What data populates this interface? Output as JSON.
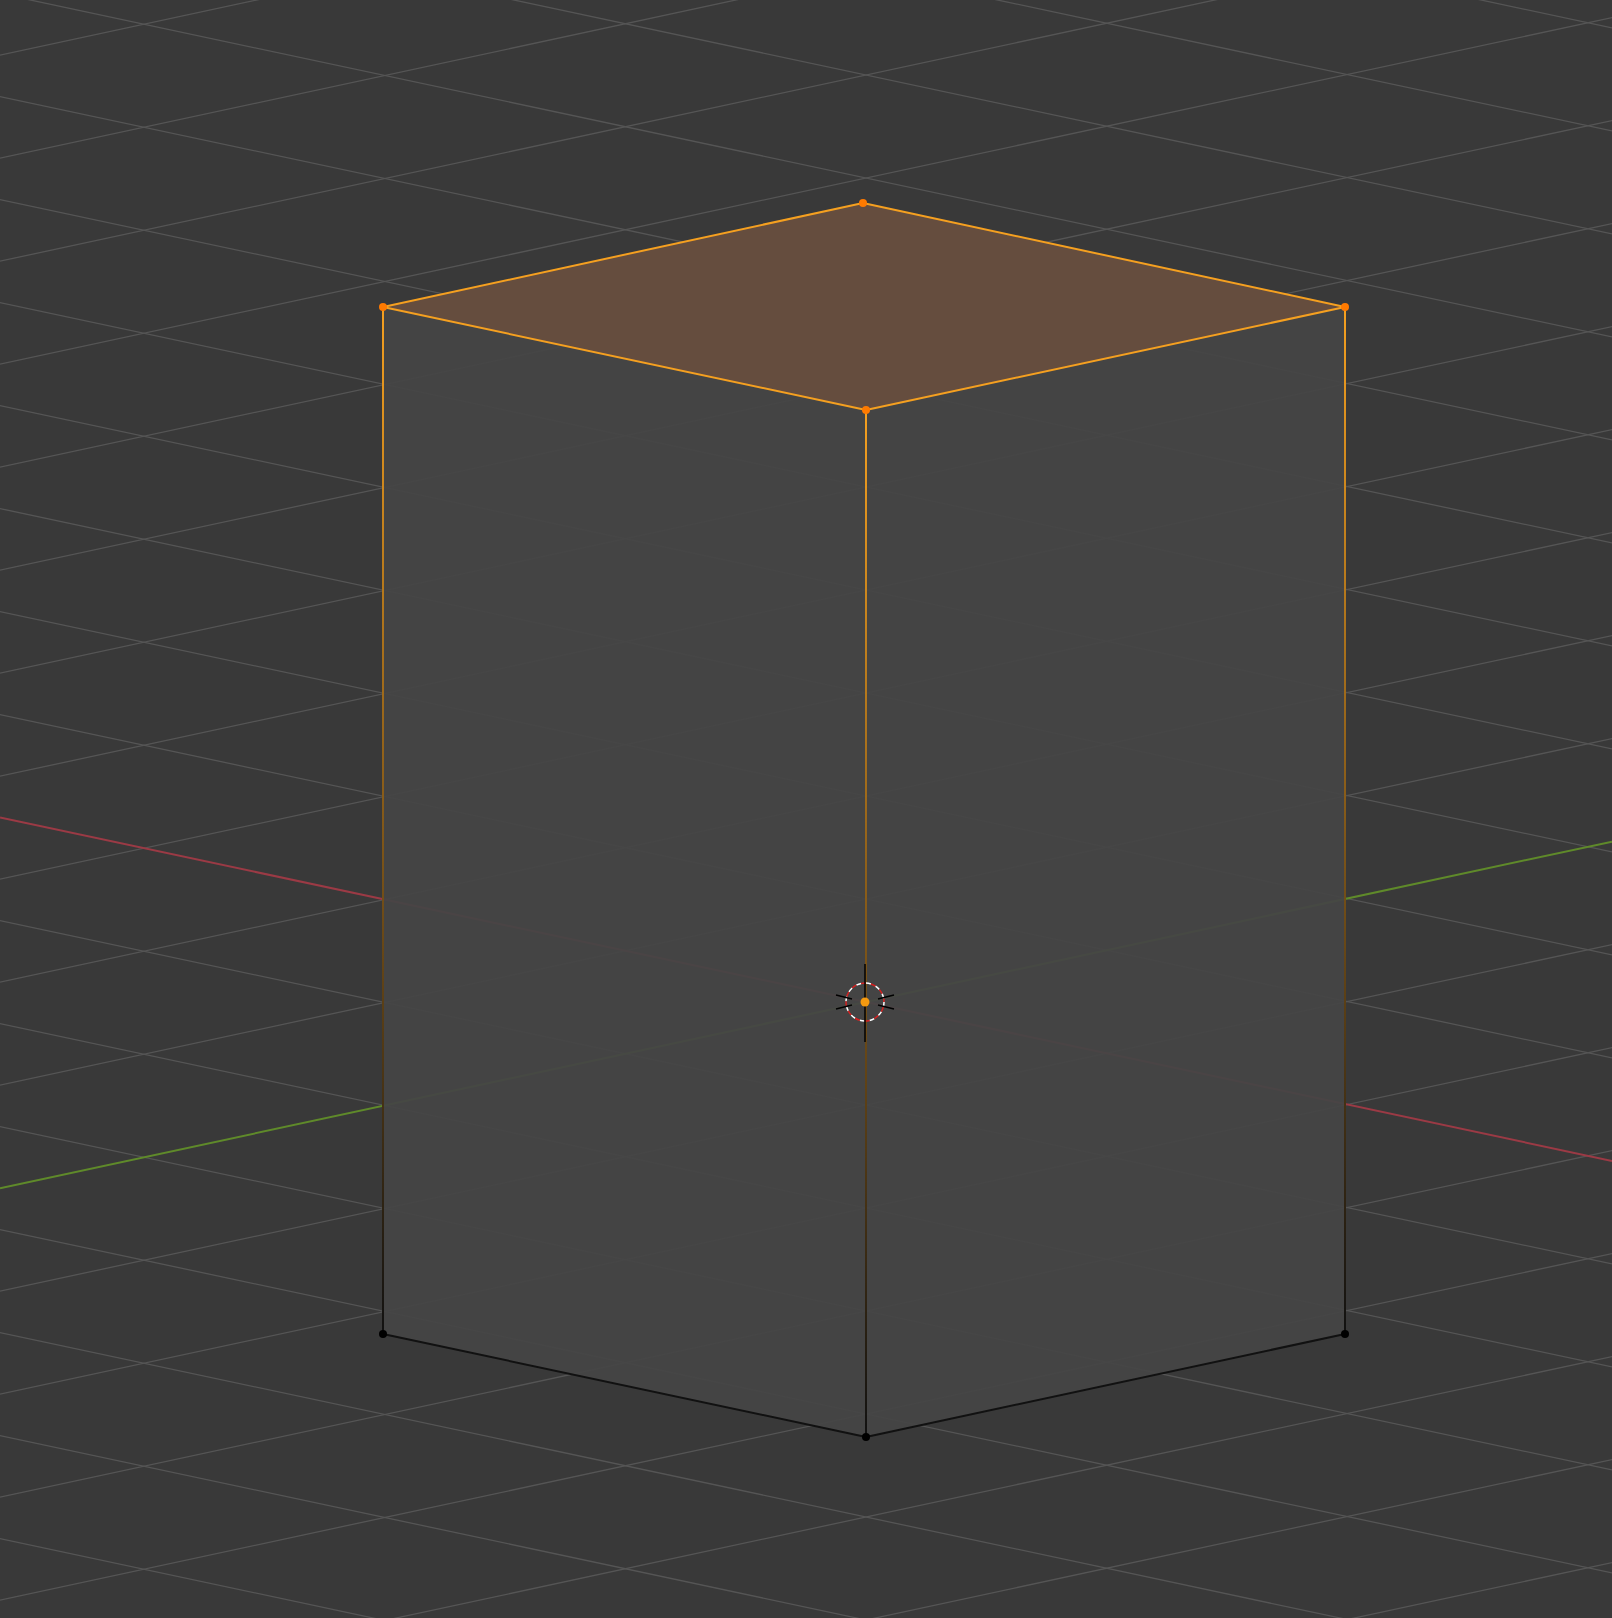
{
  "mesh": {
    "faces": [
      {
        "selected": true
      },
      {
        "selected": false
      },
      {
        "selected": false
      }
    ],
    "vertices": [
      {
        "selected": true
      },
      {
        "selected": true
      },
      {
        "selected": true
      },
      {
        "selected": true
      },
      {
        "selected": false
      },
      {
        "selected": false
      },
      {
        "selected": false
      }
    ]
  }
}
